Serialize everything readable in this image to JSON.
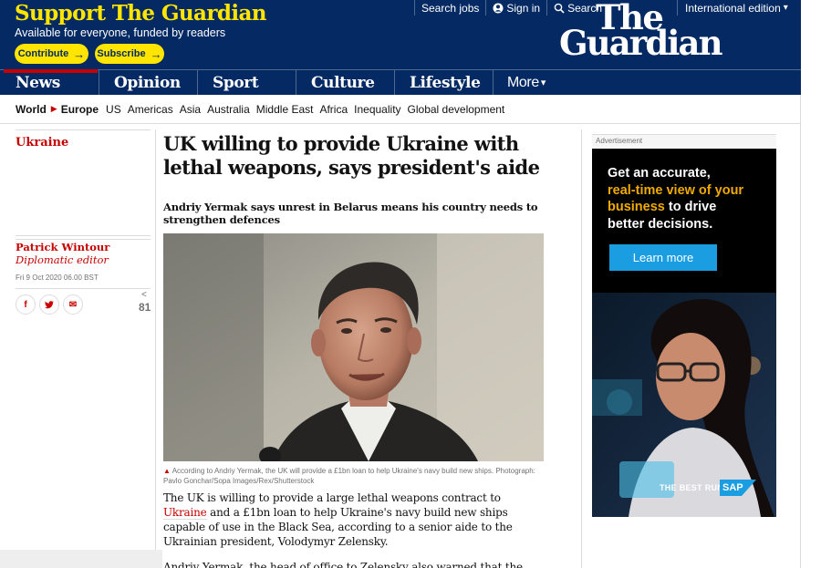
{
  "support": {
    "title": "Support The Guardian",
    "subtitle": "Available for everyone, funded by readers",
    "contribute_label": "Contribute",
    "subscribe_label": "Subscribe",
    "arrow_icon": "arrow-right-icon"
  },
  "utility": {
    "search_jobs": "Search jobs",
    "sign_in": "Sign in",
    "search": "Search",
    "edition": "International edition",
    "edition_chevron": "▾"
  },
  "logo": {
    "line1": "The",
    "line2": "Guardian"
  },
  "pillars": {
    "news": "News",
    "opinion": "Opinion",
    "sport": "Sport",
    "culture": "Culture",
    "lifestyle": "Lifestyle",
    "more": "More",
    "more_chevron": "▾",
    "active": "News",
    "active_color": "#c70000"
  },
  "subnav": {
    "world": "World",
    "current": "Europe",
    "items": [
      "US",
      "Americas",
      "Asia",
      "Australia",
      "Middle East",
      "Africa",
      "Inequality",
      "Global development"
    ]
  },
  "article": {
    "section": "Ukraine",
    "headline": "UK willing to provide Ukraine with lethal weapons, says president's aide",
    "standfirst": "Andriy Yermak says unrest in Belarus means his country needs to strengthen defences",
    "author": "Patrick Wintour",
    "author_role": "Diplomatic editor",
    "date": "Fri 9 Oct 2020 06.00 BST",
    "share_count": "81",
    "caption": "According to Andriy Yermak, the UK will provide a £1bn loan to help Ukraine's navy build new ships. Photograph: Pavlo Gonchar/Sopa Images/Rex/Shutterstock",
    "body_1_before": "The UK is willing to provide a large lethal weapons contract to ",
    "body_1_link": "Ukraine",
    "body_1_after": " and a £1bn loan to help Ukraine's navy build new ships capable of use in the Black Sea, according to a senior aide to the Ukrainian president, Volodymyr Zelensky.",
    "body_2": "Andriy Yermak, the head of office to Zelensky also warned that the"
  },
  "share": {
    "facebook_icon": "f",
    "twitter_icon": "t",
    "email_icon": "✉",
    "count_icon": "<"
  },
  "ad": {
    "label": "Advertisement",
    "line1": "Get an accurate,",
    "line2": "real-time view of your",
    "line3_hl": "business",
    "line3_rest": " to drive",
    "line4": "better decisions.",
    "cta": "Learn more",
    "tagline": "THE BEST RUN",
    "brand": "SAP",
    "accent_color": "#f0ab00",
    "cta_color": "#1a9ee1"
  },
  "colors": {
    "brand_blue": "#052962",
    "support_yellow": "#ffe500",
    "news_red": "#c70000"
  }
}
